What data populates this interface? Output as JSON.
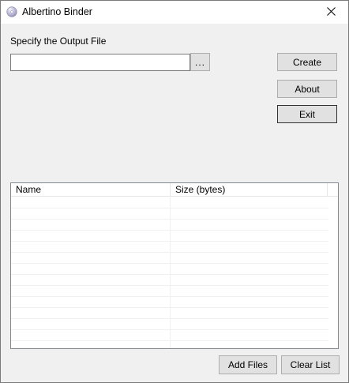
{
  "window": {
    "title": "Albertino Binder",
    "icon": "disc-icon",
    "close_icon": "close-icon"
  },
  "output": {
    "label": "Specify the Output File",
    "value": "",
    "browse_label": "..."
  },
  "buttons": {
    "create": "Create",
    "about": "About",
    "exit": "Exit",
    "add_files": "Add Files",
    "clear_list": "Clear List"
  },
  "file_list": {
    "columns": [
      "Name",
      "Size (bytes)"
    ],
    "rows": []
  }
}
